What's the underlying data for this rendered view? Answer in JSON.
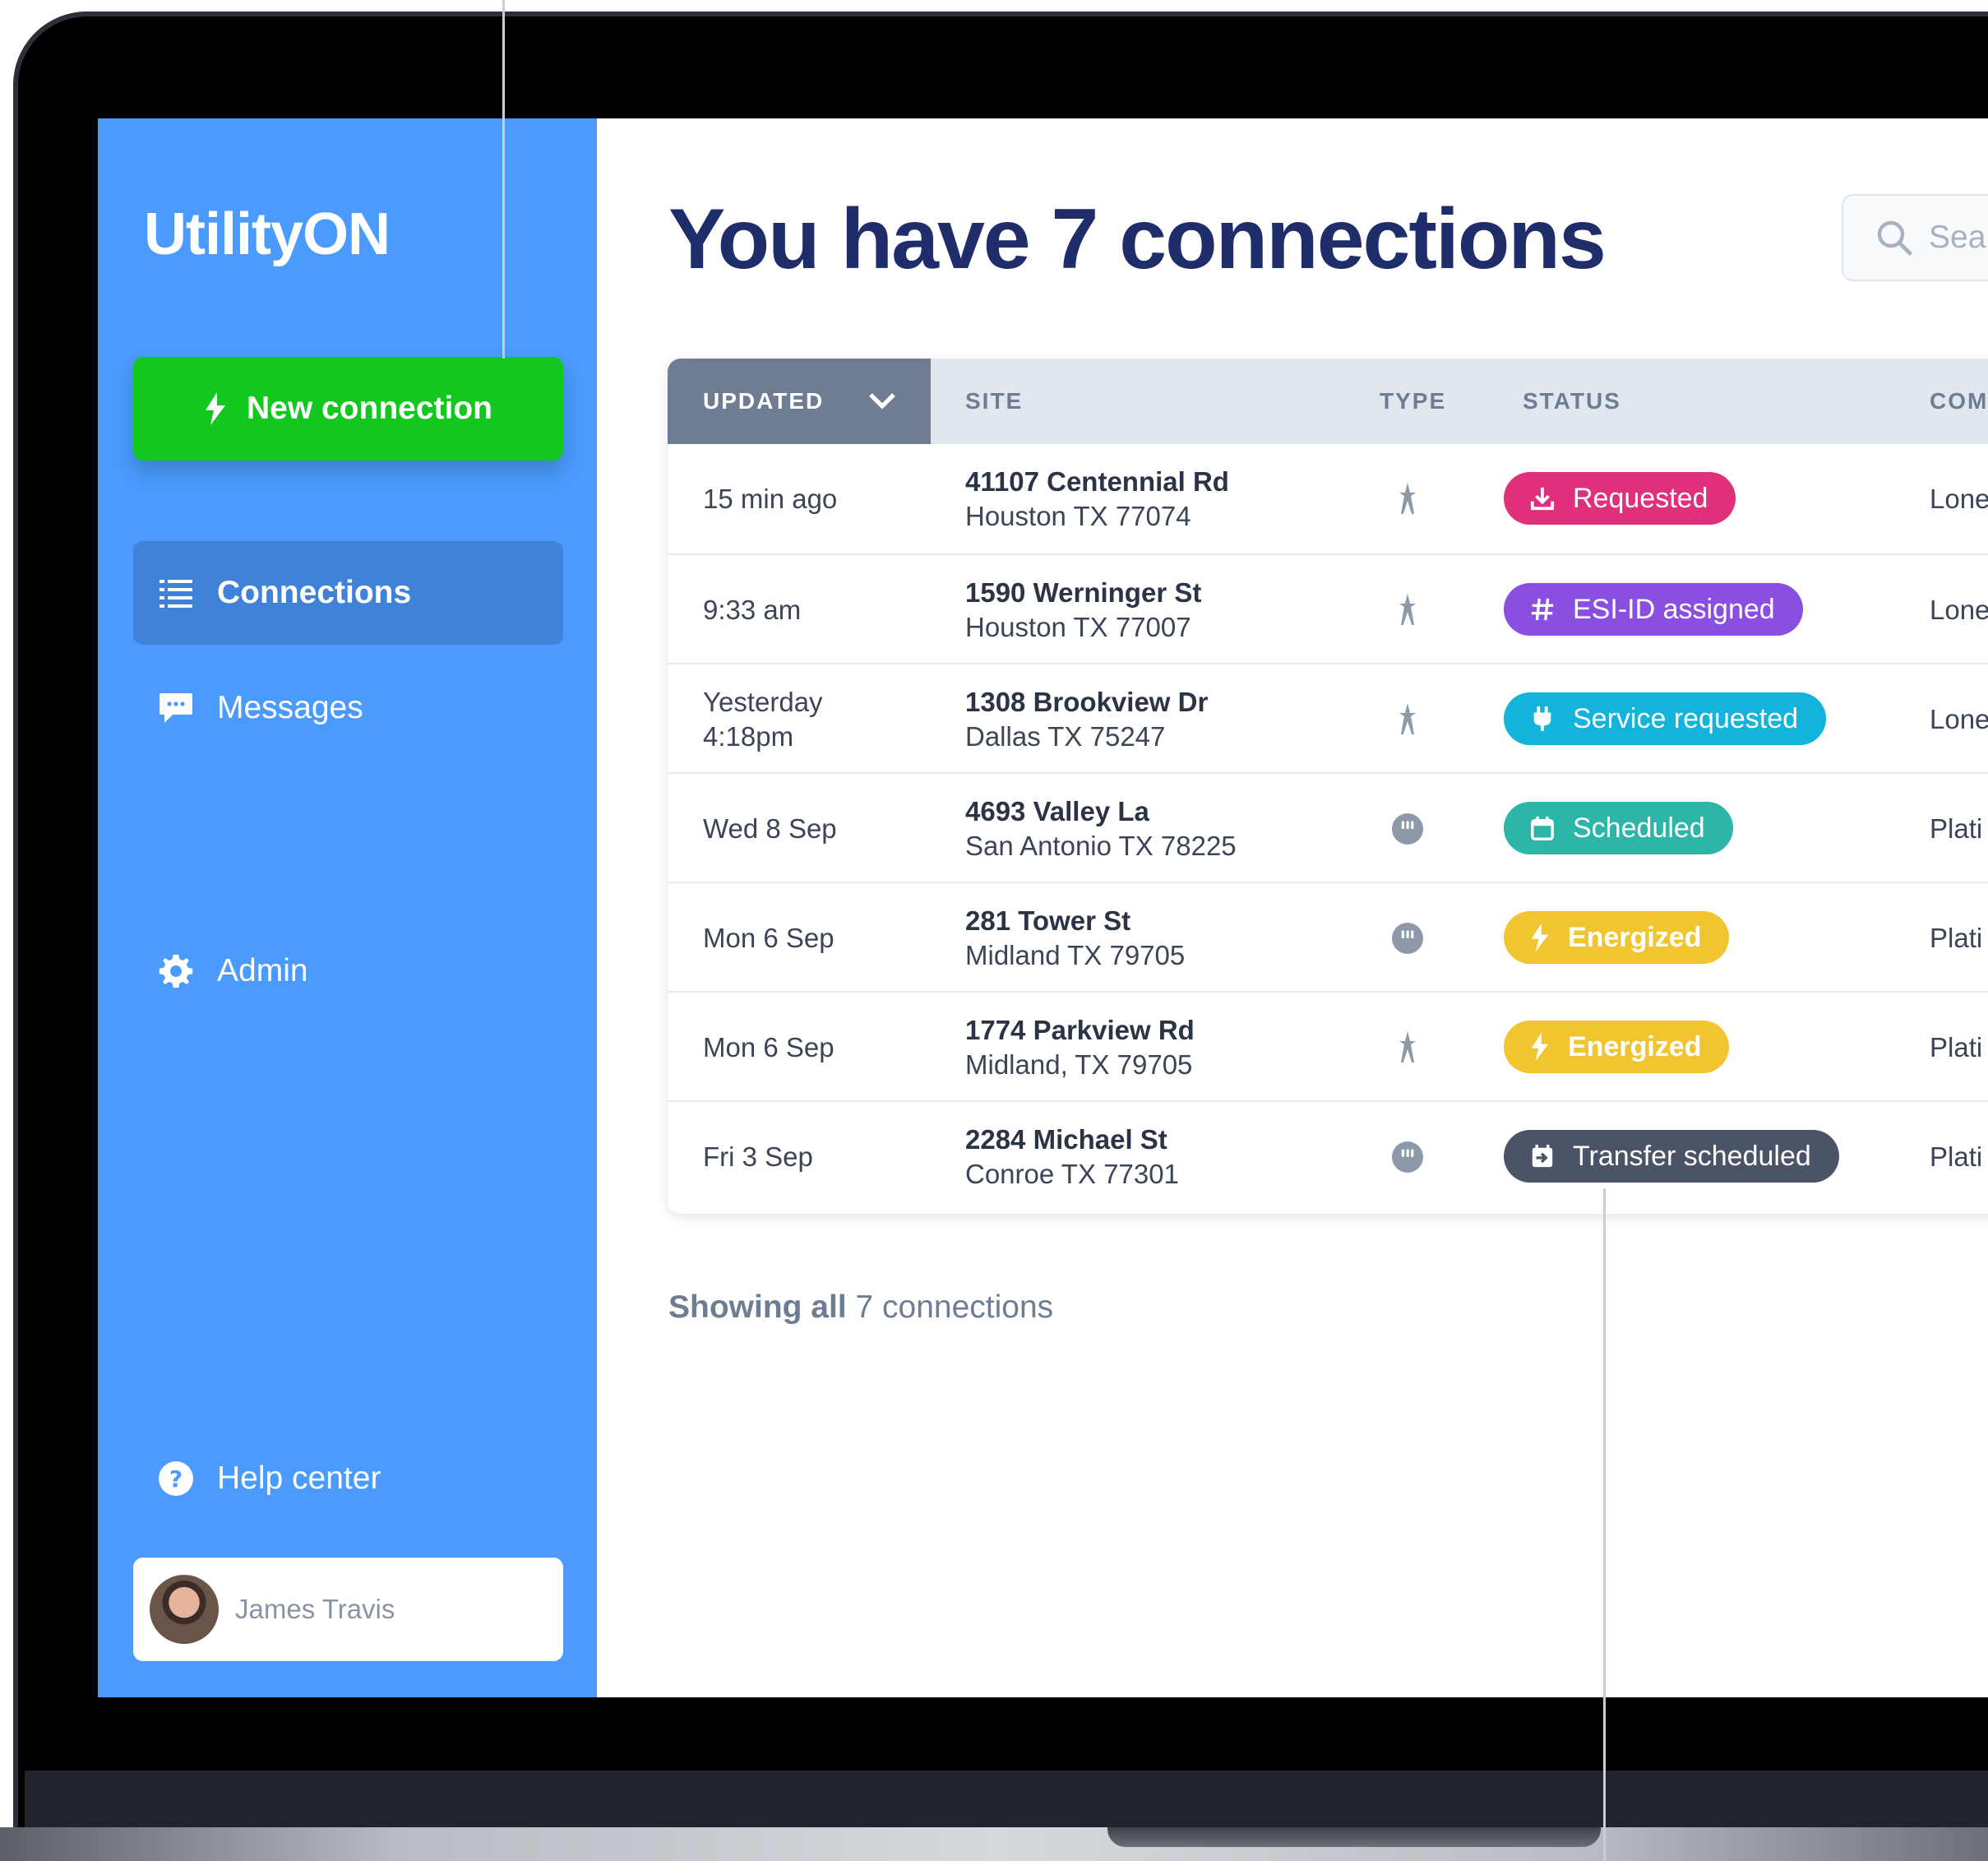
{
  "app": {
    "logo_text": "Utility",
    "logo_text_on": "ON"
  },
  "sidebar": {
    "new_button": "New connection",
    "items": [
      {
        "label": "Connections",
        "icon": "list-icon",
        "active": true
      },
      {
        "label": "Messages",
        "icon": "chat-bubble-icon"
      },
      {
        "label": "Admin",
        "icon": "gear-icon"
      },
      {
        "label": "Help center",
        "icon": "help-circle-icon"
      }
    ],
    "user": {
      "name": "James Travis"
    }
  },
  "main": {
    "title": "You have 7 connections",
    "search_placeholder": "Sea",
    "footer_bold": "Showing all",
    "footer_rest": " 7 connections"
  },
  "table": {
    "headers": [
      "UPDATED",
      "SITE",
      "TYPE",
      "STATUS",
      "COM"
    ],
    "rows": [
      {
        "updated": [
          "15 min ago"
        ],
        "street": "41107 Centennial Rd",
        "city": "Houston TX 77074",
        "type": "electric-tower-icon",
        "status": "Requested",
        "status_icon": "download-icon",
        "status_color": "#e0307b",
        "company": "Lone"
      },
      {
        "updated": [
          "9:33 am"
        ],
        "street": "1590 Werninger St",
        "city": "Houston TX 77007",
        "type": "electric-tower-icon",
        "status": "ESI-ID assigned",
        "status_icon": "hash-icon",
        "status_color": "#8a4fe0",
        "company": "Lone"
      },
      {
        "updated": [
          "Yesterday",
          "4:18pm"
        ],
        "street": "1308 Brookview Dr",
        "city": "Dallas TX 75247",
        "type": "electric-tower-icon",
        "status": "Service requested",
        "status_icon": "plug-icon",
        "status_color": "#12b4dc",
        "company": "Lone"
      },
      {
        "updated": [
          "Wed 8 Sep"
        ],
        "street": "4693 Valley La",
        "city": "San Antonio TX 78225",
        "type": "outlet-icon",
        "status": "Scheduled",
        "status_icon": "calendar-icon",
        "status_color": "#2db5a8",
        "company": "Plati"
      },
      {
        "updated": [
          "Mon 6 Sep"
        ],
        "street": "281 Tower St",
        "city": "Midland TX 79705",
        "type": "outlet-icon",
        "status": "Energized",
        "status_icon": "lightning-icon",
        "status_color": "#f0c530",
        "company": "Plati"
      },
      {
        "updated": [
          "Mon 6 Sep"
        ],
        "street": "1774 Parkview Rd",
        "city": "Midland, TX 79705",
        "type": "electric-tower-icon",
        "status": "Energized",
        "status_icon": "lightning-icon",
        "status_color": "#f0c530",
        "company": "Plati"
      },
      {
        "updated": [
          "Fri 3 Sep"
        ],
        "street": "2284 Michael St",
        "city": "Conroe TX 77301",
        "type": "outlet-icon",
        "status": "Transfer scheduled",
        "status_icon": "transfer-icon",
        "status_color": "#4a5466",
        "company": "Plati"
      }
    ]
  },
  "colors": {
    "sidebar": "#4a9bfd",
    "new_button": "#12c81f",
    "title": "#1f2d6b",
    "header_active": "#6e7d92"
  }
}
